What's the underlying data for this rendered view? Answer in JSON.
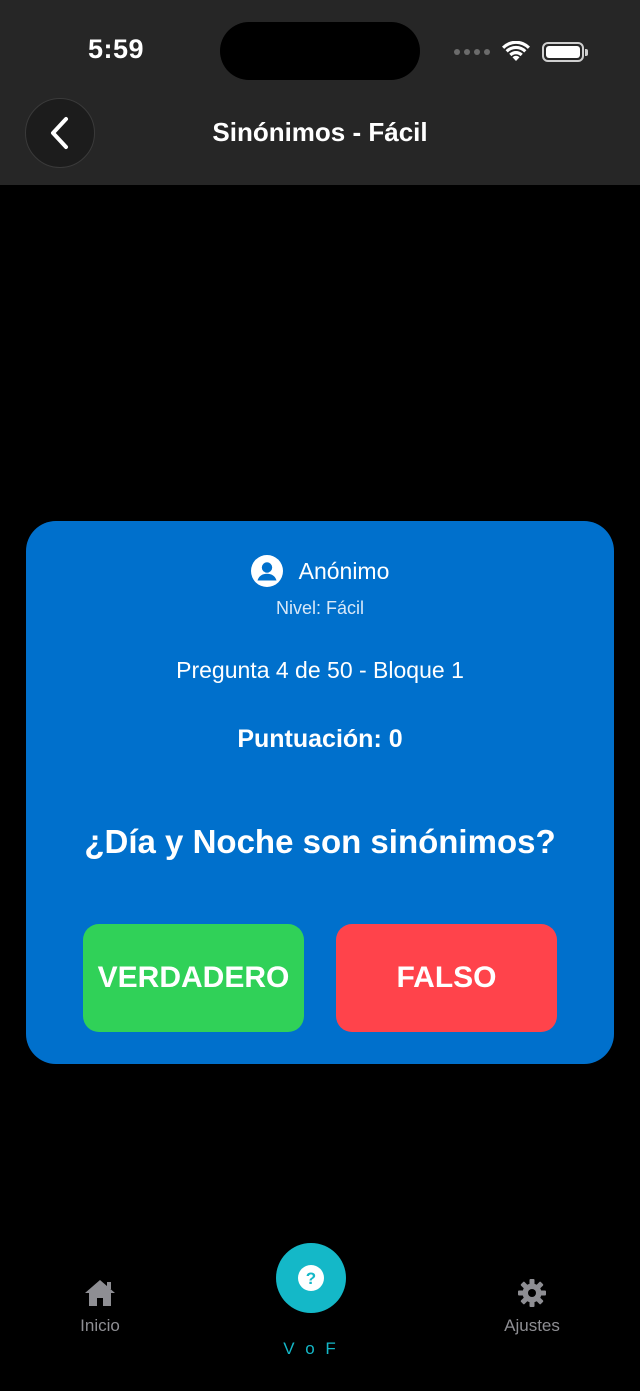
{
  "status_bar": {
    "time": "5:59"
  },
  "header": {
    "title": "Sinónimos - Fácil",
    "back_icon": "chevron-left-icon"
  },
  "card": {
    "user_name": "Anónimo",
    "user_icon": "user-circle-icon",
    "level": "Nivel: Fácil",
    "progress": "Pregunta 4 de 50 - Bloque 1",
    "score": "Puntuación: 0",
    "question": "¿Día y Noche son sinónimos?",
    "true_label": "VERDADERO",
    "false_label": "FALSO"
  },
  "tab_bar": {
    "items": [
      {
        "label": "Inicio",
        "icon": "home-icon"
      },
      {
        "label": "V o F",
        "icon": "question-circle-icon",
        "active": true
      },
      {
        "label": "Ajustes",
        "icon": "gear-icon"
      }
    ]
  },
  "colors": {
    "header_bg": "#262626",
    "card_bg": "#0070cc",
    "true_button": "#30d158",
    "false_button": "#ff434b",
    "accent": "#14b8c8",
    "inactive_tab": "#8e8e93"
  }
}
